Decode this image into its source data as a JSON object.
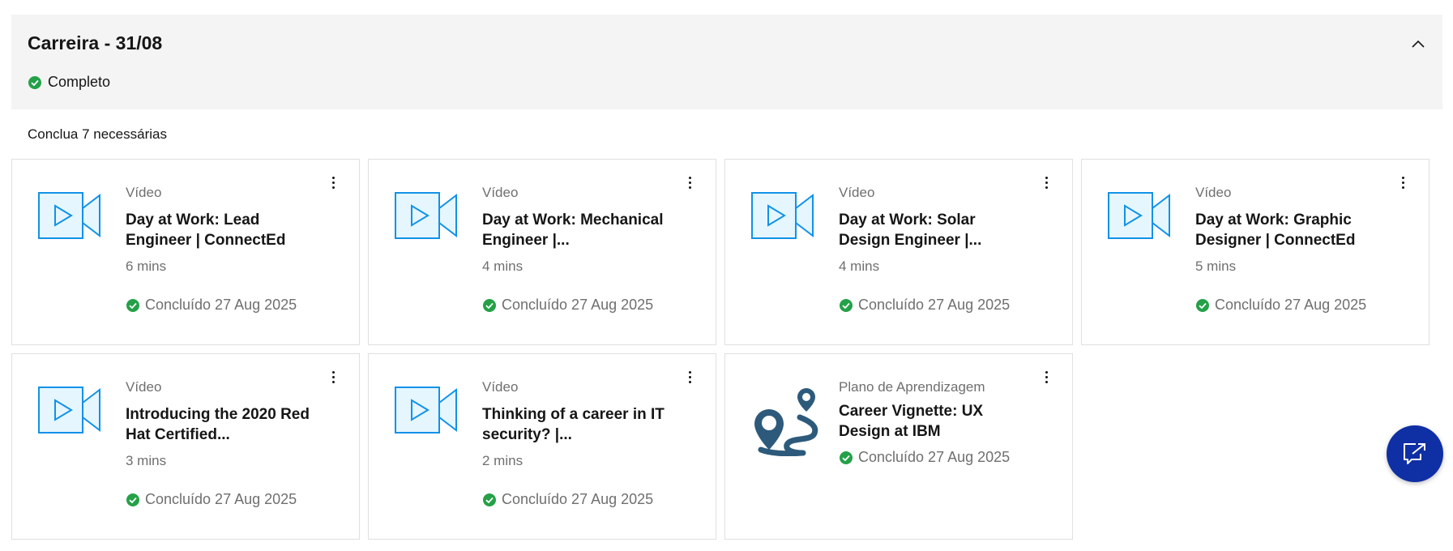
{
  "section": {
    "title": "Carreira - 31/08",
    "status": "Completo",
    "requirement": "Conclua 7 necessárias"
  },
  "cards": [
    {
      "type": "Vídeo",
      "title": "Day at Work: Lead Engineer | ConnectEd",
      "duration": "6 mins",
      "completed": "Concluído 27 Aug 2025",
      "icon": "video-camera-icon"
    },
    {
      "type": "Vídeo",
      "title": "Day at Work: Mechanical Engineer |...",
      "duration": "4 mins",
      "completed": "Concluído 27 Aug 2025",
      "icon": "video-camera-icon"
    },
    {
      "type": "Vídeo",
      "title": "Day at Work: Solar Design Engineer |...",
      "duration": "4 mins",
      "completed": "Concluído 27 Aug 2025",
      "icon": "video-camera-icon"
    },
    {
      "type": "Vídeo",
      "title": "Day at Work: Graphic Designer | ConnectEd",
      "duration": "5 mins",
      "completed": "Concluído 27 Aug 2025",
      "icon": "video-camera-icon"
    },
    {
      "type": "Vídeo",
      "title": "Introducing the 2020 Red Hat Certified...",
      "duration": "3 mins",
      "completed": "Concluído 27 Aug 2025",
      "icon": "video-camera-icon"
    },
    {
      "type": "Vídeo",
      "title": "Thinking of a career in IT security? |...",
      "duration": "2 mins",
      "completed": "Concluído 27 Aug 2025",
      "icon": "video-camera-icon"
    },
    {
      "type": "Plano de Aprendizagem",
      "title": "Career Vignette: UX Design at IBM",
      "completed": "Concluído 27 Aug 2025",
      "icon": "learning-path-map-icon"
    }
  ],
  "colors": {
    "success": "#24a148",
    "videoStroke": "#1192e8",
    "videoFill": "#e5f6ff",
    "pathIcon": "#2d5a7b",
    "fab": "#0f2fa4"
  },
  "icons": {
    "collapse": "chevron-up-icon",
    "menu": "overflow-menu-icon",
    "fab": "chat-launch-icon"
  }
}
